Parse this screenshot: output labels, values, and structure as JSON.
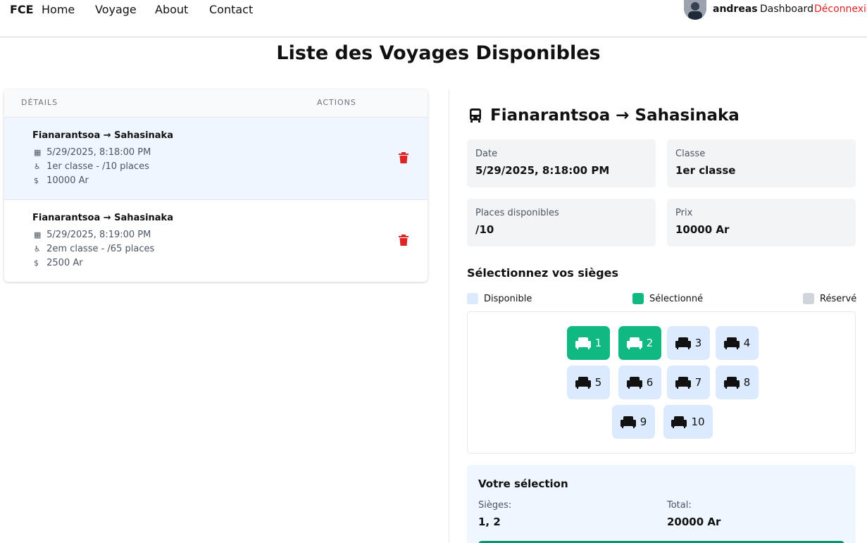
{
  "nav": {
    "brand": "FCE",
    "links": [
      "Home",
      "Voyage",
      "About",
      "Contact"
    ],
    "username": "andreas",
    "dashboard": "Dashboard",
    "logout": "Déconnexio"
  },
  "page_title": "Liste des Voyages Disponibles",
  "table": {
    "headers": [
      "DÉTAILS",
      "ACTIONS"
    ],
    "rows": [
      {
        "route": "Fianarantsoa → Sahasinaka",
        "date": "5/29/2025, 8:18:00 PM",
        "classe": "1er classe - /10 places",
        "prix": "10000 Ar"
      },
      {
        "route": "Fianarantsoa → Sahasinaka",
        "date": "5/29/2025, 8:19:00 PM",
        "classe": "2em classe - /65 places",
        "prix": "2500 Ar"
      }
    ]
  },
  "detail": {
    "title": "Fianarantsoa → Sahasinaka",
    "date_label": "Date",
    "date_value": "5/29/2025, 8:18:00 PM",
    "classe_label": "Classe",
    "classe_value": "1er classe",
    "places_label": "Places disponibles",
    "places_value": "/10",
    "prix_label": "Prix",
    "prix_value": "10000 Ar"
  },
  "seats": {
    "heading": "Sélectionnez vos sièges",
    "legend": {
      "available": "Disponible",
      "selected": "Sélectionné",
      "reserved": "Réservé"
    },
    "labels": [
      "1",
      "2",
      "3",
      "4",
      "5",
      "6",
      "7",
      "8",
      "9",
      "10"
    ],
    "selected": [
      "1",
      "2"
    ]
  },
  "summary": {
    "title": "Votre sélection",
    "seats_label": "Sièges:",
    "seats_value": "1, 2",
    "total_label": "Total:",
    "total_value": "20000 Ar"
  },
  "colors": {
    "accent_green": "#10b981",
    "seat_available": "#dbeafe",
    "seat_reserved": "#d1d5db",
    "danger": "#dc2626",
    "active_row": "#eff6ff"
  }
}
